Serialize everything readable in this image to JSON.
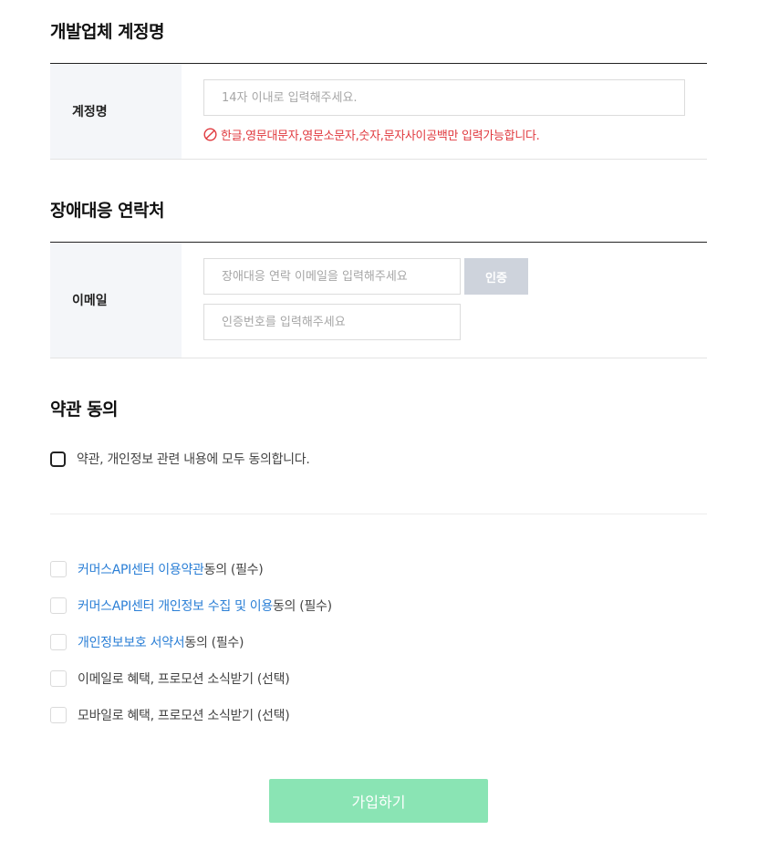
{
  "account_section": {
    "title": "개발업체 계정명",
    "label": "계정명",
    "input_placeholder": "14자 이내로 입력해주세요.",
    "input_value": "",
    "error_text": "한글,영문대문자,영문소문자,숫자,문자사이공백만 입력가능합니다."
  },
  "contact_section": {
    "title": "장애대응 연락처",
    "label": "이메일",
    "email_placeholder": "장애대응 연락 이메일을 입력해주세요",
    "verify_button": "인증",
    "code_placeholder": "인증번호를 입력해주세요"
  },
  "terms_section": {
    "title": "약관 동의",
    "agree_all": "약관, 개인정보 관련 내용에 모두 동의합니다.",
    "items": [
      {
        "link": "커머스API센터 이용약관",
        "suffix": " 동의 (필수)"
      },
      {
        "link": "커머스API센터 개인정보 수집 및 이용",
        "suffix": " 동의 (필수)"
      },
      {
        "link": "개인정보보호 서약서",
        "suffix": " 동의 (필수)"
      },
      {
        "link": "",
        "suffix": "이메일로 혜택, 프로모션 소식받기 (선택)"
      },
      {
        "link": "",
        "suffix": "모바일로 혜택, 프로모션 소식받기 (선택)"
      }
    ]
  },
  "join_button": "가입하기",
  "colors": {
    "error": "#e0393e",
    "link": "#2b7fd6",
    "join_button": "#8ae4b4",
    "verify_button": "#ced3dc",
    "label_bg": "#f4f6f9"
  },
  "icons": {
    "error": "prohibited-circle-icon"
  }
}
